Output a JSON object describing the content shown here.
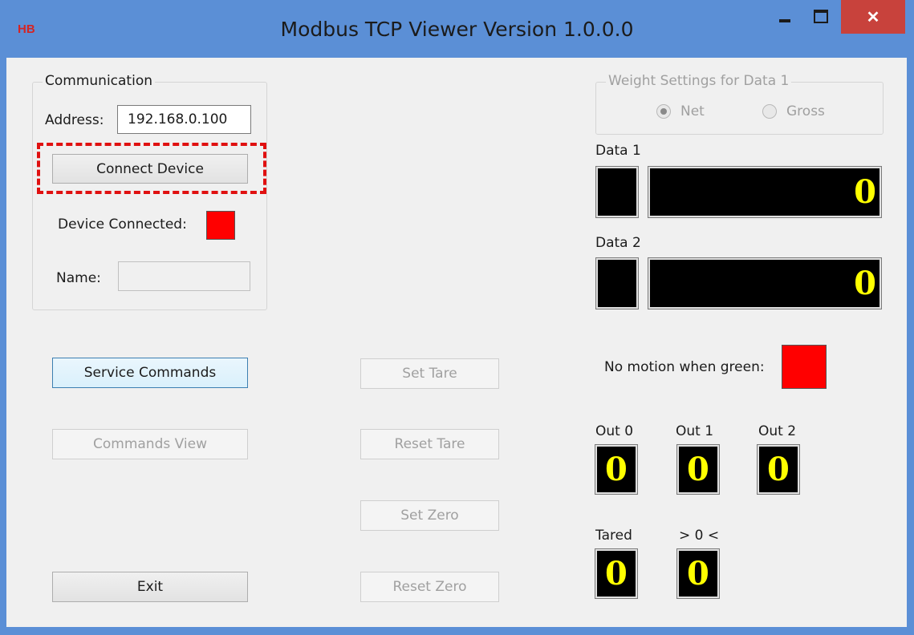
{
  "window": {
    "icon_text": "HB",
    "title": "Modbus TCP Viewer Version 1.0.0.0",
    "close_glyph": "✕"
  },
  "communication": {
    "legend": "Communication",
    "address_label": "Address:",
    "address_value": "192.168.0.100",
    "connect_button": "Connect Device",
    "device_connected_label": "Device Connected:",
    "device_connected_color": "#ff0000",
    "name_label": "Name:",
    "name_value": ""
  },
  "left_buttons": {
    "service_commands": "Service Commands",
    "commands_view": "Commands View",
    "exit": "Exit"
  },
  "mid_buttons": {
    "set_tare": "Set Tare",
    "reset_tare": "Reset Tare",
    "set_zero": "Set Zero",
    "reset_zero": "Reset Zero"
  },
  "weight_settings": {
    "legend": "Weight Settings for Data 1",
    "options": [
      "Net",
      "Gross"
    ],
    "selected": "Net"
  },
  "data1": {
    "label": "Data 1",
    "value": "0"
  },
  "data2": {
    "label": "Data 2",
    "value": "0"
  },
  "motion": {
    "label": "No motion when green:",
    "color": "#ff0000"
  },
  "outputs": [
    {
      "label": "Out 0",
      "value": "0"
    },
    {
      "label": "Out 1",
      "value": "0"
    },
    {
      "label": "Out 2",
      "value": "0"
    }
  ],
  "status": [
    {
      "label": "Tared",
      "value": "0"
    },
    {
      "label": "> 0 <",
      "value": "0"
    }
  ],
  "colors": {
    "titlebar": "#5b8fd6",
    "close_button": "#c8423c",
    "highlight": "#e01010",
    "digit": "#ffff00"
  }
}
